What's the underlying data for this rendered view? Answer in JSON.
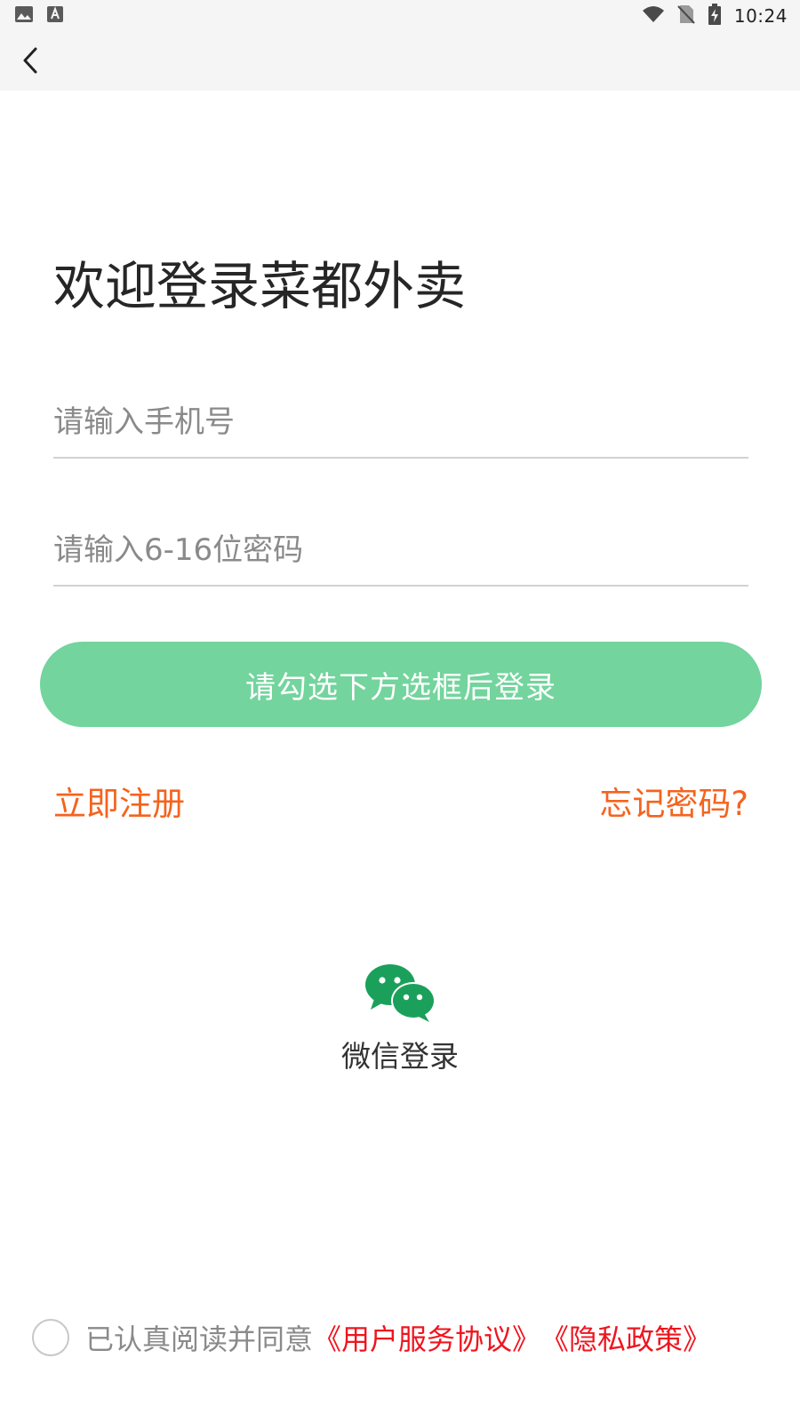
{
  "status_bar": {
    "time": "10:24",
    "icons": [
      "image-icon",
      "a-badge-icon",
      "wifi-icon",
      "no-sim-icon",
      "battery-charging-icon"
    ]
  },
  "header": {
    "back_icon": "chevron-left-icon"
  },
  "login": {
    "title": "欢迎登录菜都外卖",
    "phone_placeholder": "请输入手机号",
    "password_placeholder": "请输入6-16位密码",
    "login_button": "请勾选下方选框后登录",
    "register_link": "立即注册",
    "forgot_link": "忘记密码?",
    "wechat_label": "微信登录"
  },
  "agreement": {
    "text": "已认真阅读并同意",
    "user_agreement": "《用户服务协议》",
    "privacy_policy": "《隐私政策》",
    "checked": false
  },
  "colors": {
    "accent_green": "#73d49d",
    "wechat_green": "#1aa05a",
    "link_orange": "#f5631e",
    "link_red": "#f0141e",
    "header_bg": "#f5f5f5"
  }
}
